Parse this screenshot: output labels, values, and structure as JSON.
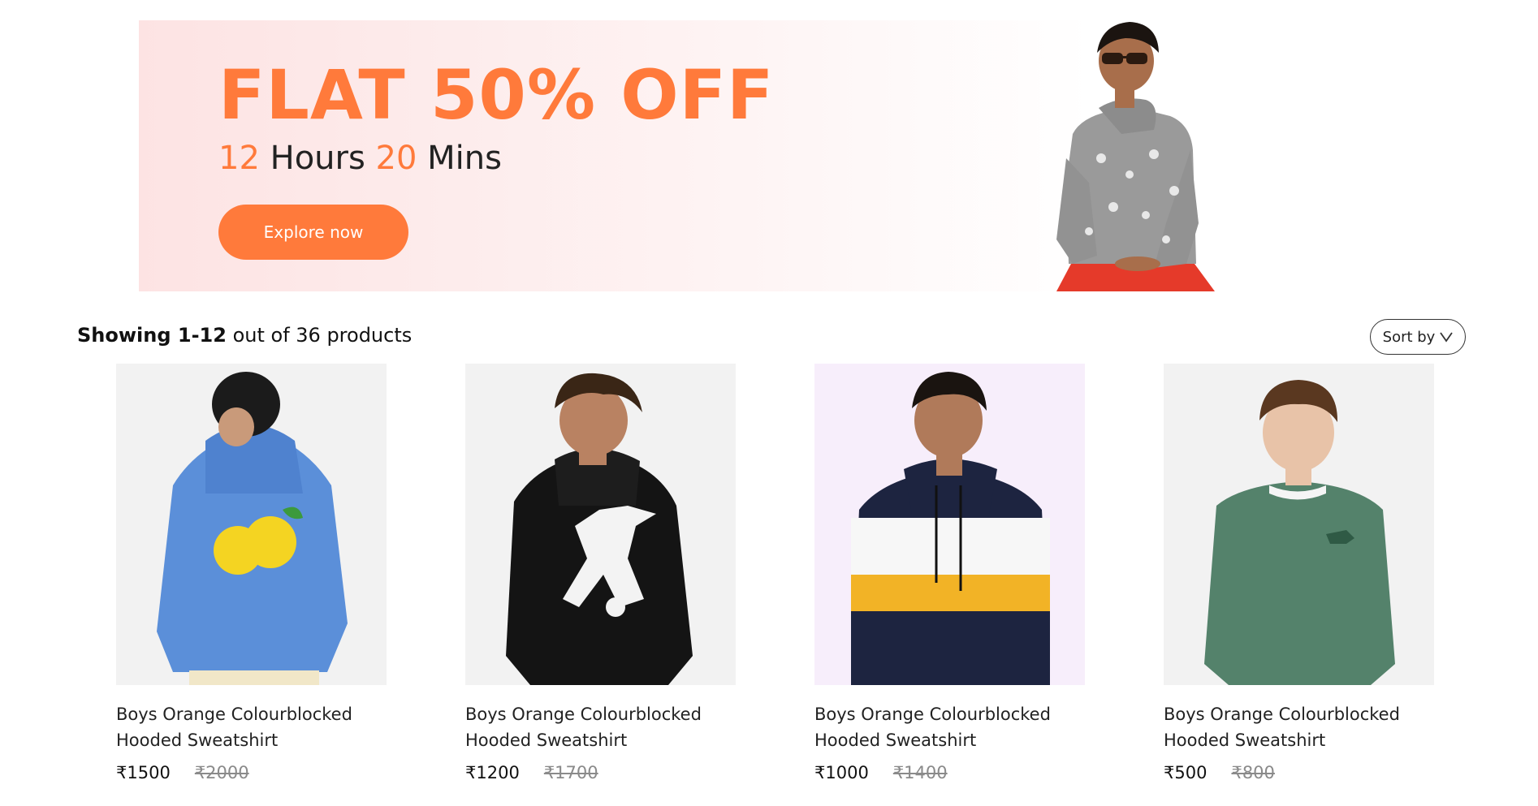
{
  "banner": {
    "headline": "FLAT 50% OFF",
    "countdown": {
      "hours_value": "12",
      "hours_unit": "Hours",
      "mins_value": "20",
      "mins_unit": "Mins"
    },
    "cta_label": "Explore now",
    "accent_color": "#ff7a3b"
  },
  "results": {
    "showing_bold": "Showing 1-12",
    "showing_rest": "out of 36 products",
    "sort_label": "Sort by",
    "sort_icon": "chevron-down-icon"
  },
  "products": [
    {
      "name": "Boys Orange Colourblocked Hooded Sweatshirt",
      "price": "₹1500",
      "mrp": "₹2000",
      "image": "blue-lemon-hoodie"
    },
    {
      "name": "Boys Orange Colourblocked Hooded Sweatshirt",
      "price": "₹1200",
      "mrp": "₹1700",
      "image": "black-football-hoodie"
    },
    {
      "name": "Boys Orange Colourblocked Hooded Sweatshirt",
      "price": "₹1000",
      "mrp": "₹1400",
      "image": "striped-colourblock-hoodie"
    },
    {
      "name": "Boys Orange Colourblocked Hooded Sweatshirt",
      "price": "₹500",
      "mrp": "₹800",
      "image": "green-dino-sweatshirt"
    }
  ]
}
